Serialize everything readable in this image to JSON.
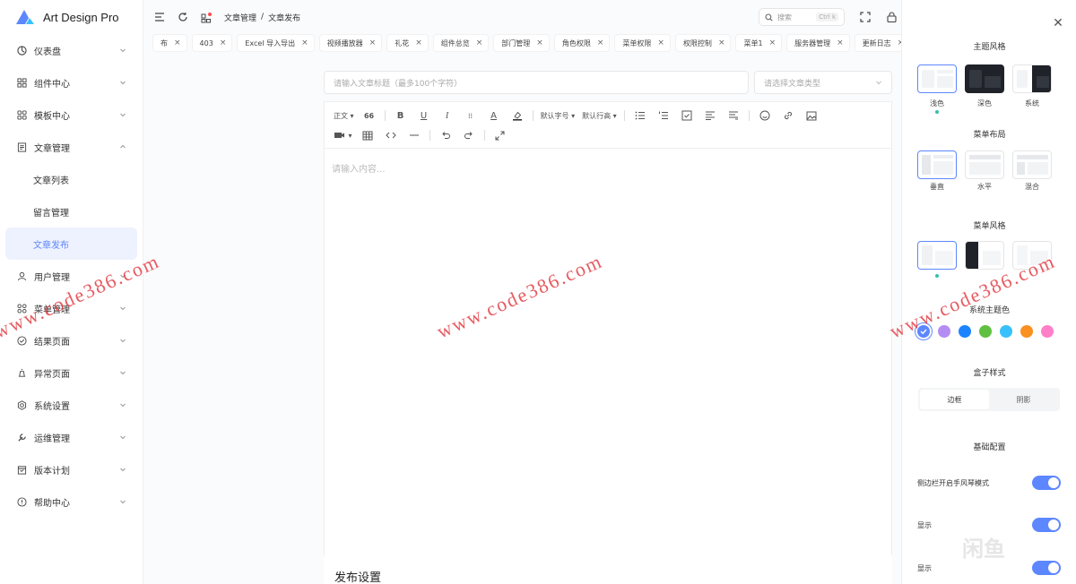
{
  "app": {
    "name": "Art Design Pro"
  },
  "sidebar": {
    "items": [
      {
        "label": "仪表盘",
        "icon": "dashboard-icon"
      },
      {
        "label": "组件中心",
        "icon": "components-icon"
      },
      {
        "label": "模板中心",
        "icon": "template-icon"
      },
      {
        "label": "文章管理",
        "icon": "article-icon",
        "expanded": true
      },
      {
        "label": "用户管理",
        "icon": "user-icon"
      },
      {
        "label": "菜单管理",
        "icon": "menu-icon"
      },
      {
        "label": "结果页面",
        "icon": "result-icon"
      },
      {
        "label": "异常页面",
        "icon": "exception-icon"
      },
      {
        "label": "系统设置",
        "icon": "settings-icon"
      },
      {
        "label": "运维管理",
        "icon": "wrench-icon"
      },
      {
        "label": "版本计划",
        "icon": "calendar-icon"
      },
      {
        "label": "帮助中心",
        "icon": "help-icon"
      }
    ],
    "sub_items": [
      {
        "label": "文章列表"
      },
      {
        "label": "留言管理"
      },
      {
        "label": "文章发布",
        "active": true
      }
    ]
  },
  "header": {
    "breadcrumb": [
      "文章管理",
      "文章发布"
    ],
    "breadcrumb_sep": "/",
    "search_placeholder": "搜索",
    "search_shortcut": "Ctrl k"
  },
  "tabs": [
    {
      "label": "布"
    },
    {
      "label": "403"
    },
    {
      "label": "Excel 导入导出"
    },
    {
      "label": "视频播放器"
    },
    {
      "label": "礼花"
    },
    {
      "label": "组件总览"
    },
    {
      "label": "部门管理"
    },
    {
      "label": "角色权限"
    },
    {
      "label": "菜单权限"
    },
    {
      "label": "权限控制"
    },
    {
      "label": "菜单1"
    },
    {
      "label": "服务器管理"
    },
    {
      "label": "更新日志"
    }
  ],
  "editor": {
    "title_placeholder": "请输入文章标题（最多100个字符）",
    "type_placeholder": "请选择文章类型",
    "content_placeholder": "请输入内容...",
    "toolbar": {
      "heading": "正文",
      "quote": "66",
      "font_size": "默认字号",
      "line_height": "默认行高"
    },
    "publish_title": "发布设置"
  },
  "settings": {
    "theme_title": "主题风格",
    "themes": [
      {
        "label": "浅色"
      },
      {
        "label": "深色"
      },
      {
        "label": "系统"
      }
    ],
    "layout_title": "菜单布局",
    "layouts": [
      {
        "label": "垂直"
      },
      {
        "label": "水平"
      },
      {
        "label": "混合"
      }
    ],
    "menu_style_title": "菜单风格",
    "color_title": "系统主题色",
    "colors": [
      "#5d87ff",
      "#b48df3",
      "#1d84ff",
      "#60c041",
      "#38c0fc",
      "#f9901f",
      "#ff80c8"
    ],
    "box_title": "盒子样式",
    "box_options": [
      {
        "label": "边框"
      },
      {
        "label": "阴影"
      }
    ],
    "basic_title": "基础配置",
    "toggles": [
      {
        "label": "侧边栏开启手风琴模式",
        "on": true
      },
      {
        "label": "显示",
        "on": true
      },
      {
        "label": "显示",
        "on": true
      }
    ]
  },
  "watermark": {
    "text": "www.code386.com",
    "logo_text": "闲鱼"
  }
}
